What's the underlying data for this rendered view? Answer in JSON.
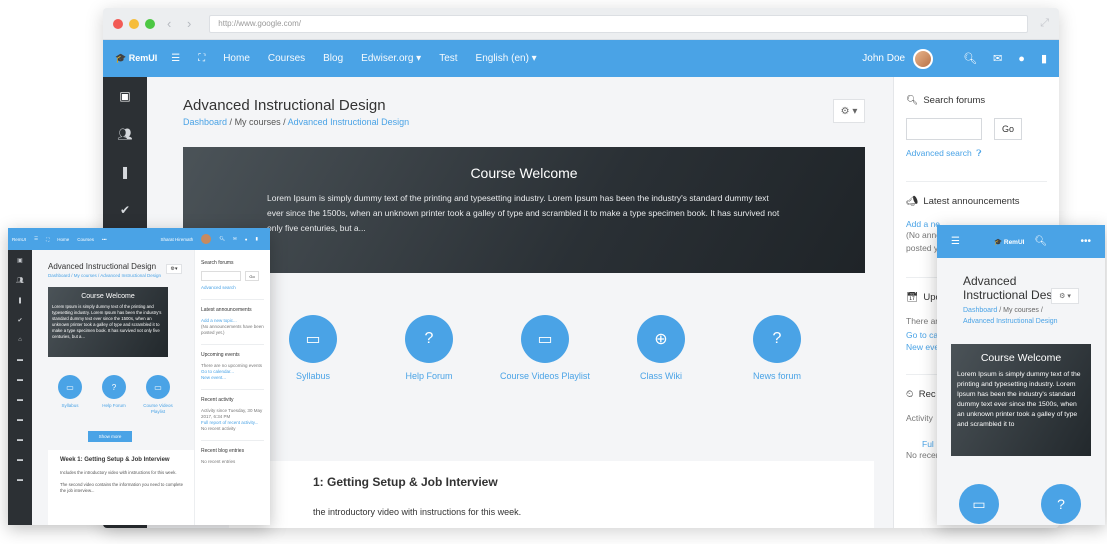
{
  "colors": {
    "accent": "#4aa3e6",
    "rail": "#2c3034",
    "hero_dark": "#22282c"
  },
  "desktop": {
    "url": "http://www.google.com/",
    "nav": {
      "brand": "RemUI",
      "links": [
        "Home",
        "Courses",
        "Blog",
        "Edwiser.org ▾",
        "Test",
        "English (en) ▾"
      ],
      "user": "John Doe"
    },
    "course": {
      "title": "Advanced Instructional Design",
      "breadcrumb": {
        "dashboard": "Dashboard",
        "my_courses": "My courses",
        "current": "Advanced Instructional Design"
      },
      "hero_title": "Course Welcome",
      "hero_text": "Lorem Ipsum is simply dummy text of the printing and typesetting industry. Lorem Ipsum has been the industry's standard dummy text ever since the 1500s, when an unknown printer took a galley of type and scrambled it to make a type specimen book. It has survived not only five centuries, but a...",
      "activities": [
        "Syllabus",
        "Help Forum",
        "Course Videos Playlist",
        "Class Wiki",
        "News forum"
      ],
      "week_title": "1: Getting Setup & Job Interview",
      "week_text": "the introductory video with instructions for this week."
    },
    "aside": {
      "search_heading": "Search forums",
      "go": "Go",
      "advanced_search": "Advanced search",
      "announcements_heading": "Latest announcements",
      "announcements_link": "Add a ne",
      "announcements_text": "(No anno",
      "announcements_text2": "posted y",
      "upcoming_heading": "Upc",
      "upcoming_text": "There ar",
      "upcoming_link1": "Go to ca",
      "upcoming_link2": "New eve",
      "recent_heading": "Rec",
      "recent_text": "Activity",
      "recent_link": "Ful",
      "recent_none": "No recer"
    }
  },
  "laptop": {
    "nav": {
      "brand": "RemUI",
      "links": [
        "Home",
        "Courses"
      ],
      "user": "Sharat Hiremath"
    },
    "title": "Advanced Instructional Design",
    "breadcrumb": "Dashboard / My courses / Advanced Instructional Design",
    "hero_title": "Course Welcome",
    "hero_text": "Lorem Ipsum is simply dummy text of the printing and typesetting industry. Lorem Ipsum has been the industry's standard dummy text ever since the 1500s, when an unknown printer took a galley of type and scrambled it to make a type specimen book. It has survived not only five centuries, but a...",
    "activities": [
      "Syllabus",
      "Help Forum",
      "Course Videos Playlist"
    ],
    "show_more": "Show more",
    "week_title": "Week 1: Getting Setup & Job Interview",
    "week_text1": "Includes the introductory video with instructions for this week.",
    "week_text2": "The second video contains the information you need to complete the job interview...",
    "aside": {
      "search": "Search forums",
      "go": "Go",
      "advanced": "Advanced search",
      "announcements": "Latest announcements",
      "ann_link": "Add a new topic...",
      "ann_text": "(No announcements have been posted yet.)",
      "upcoming": "Upcoming events",
      "up_text": "There are no upcoming events",
      "up_link1": "Go to calendar...",
      "up_link2": "New event...",
      "recent": "Recent activity",
      "rec_text": "Activity since Tuesday, 30 May 2017, 6:34 PM",
      "rec_link": "Full report of recent activity...",
      "rec_none": "No recent activity",
      "blog": "Recent blog entries",
      "blog_none": "No recent entries"
    }
  },
  "phone": {
    "brand": "RemUI",
    "title": "Advanced Instructional Des",
    "breadcrumb_dashboard": "Dashboard",
    "breadcrumb_my": "My courses",
    "breadcrumb_current": "Advanced Instructional Design",
    "hero_title": "Course Welcome",
    "hero_text": "Lorem Ipsum is simply dummy text of the printing and typesetting industry. Lorem Ipsum has been the industry's standard dummy text ever since the 1500s, when an unknown printer took a galley of type and scrambled it to"
  }
}
